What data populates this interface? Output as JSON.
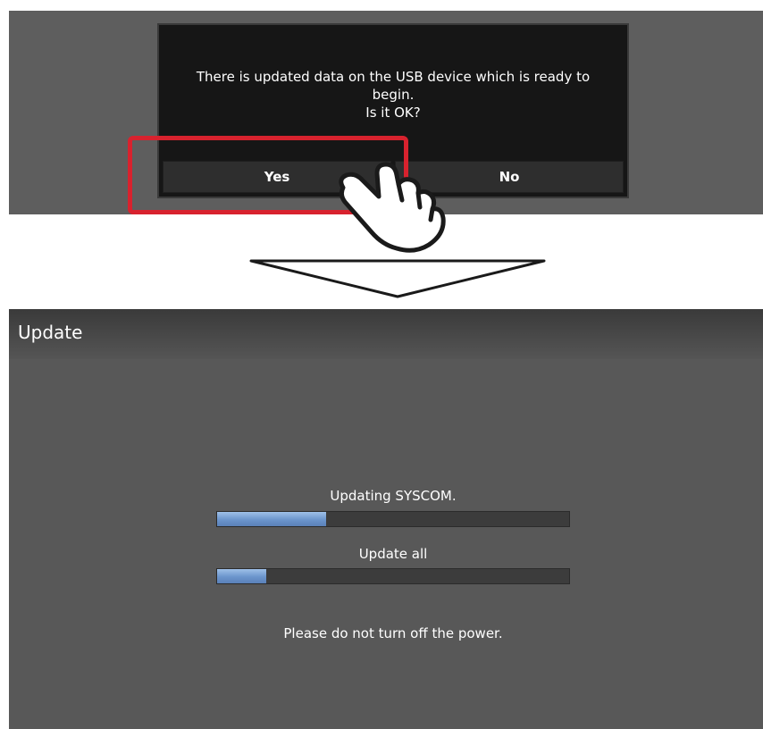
{
  "dialog": {
    "message_lines": [
      "There is updated data on the USB device which is ready to",
      "begin.",
      "Is it OK?"
    ],
    "yes_label": "Yes",
    "no_label": "No"
  },
  "update_screen": {
    "title": "Update",
    "current_task_label": "Updating SYSCOM.",
    "current_task_progress": 0.31,
    "overall_label": "Update all",
    "overall_progress": 0.14,
    "notice": "Please do not turn off the power."
  },
  "colors": {
    "highlight": "#d8222e",
    "progress_fill": "#6b95cc"
  }
}
